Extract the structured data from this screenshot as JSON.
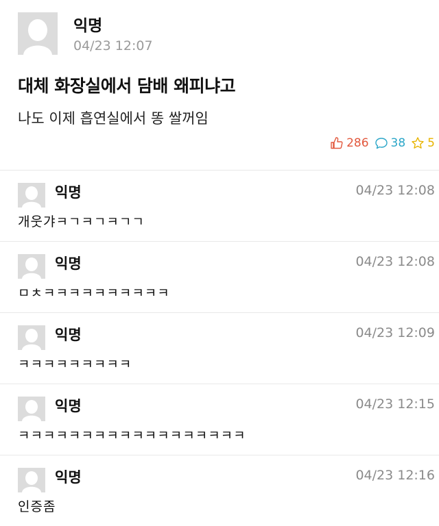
{
  "post": {
    "author": "익명",
    "time": "04/23 12:07",
    "title": "대체 화장실에서 담배 왜피냐고",
    "body": "나도 이제 흡연실에서 똥 쌀꺼임",
    "likes": "286",
    "comments": "38",
    "scraps": "5"
  },
  "comments": [
    {
      "author": "익명",
      "time": "04/23 12:08",
      "text": "개웃갸ㅋㄱㅋㄱㅋㄱㄱ"
    },
    {
      "author": "익명",
      "time": "04/23 12:08",
      "text": "ㅁㅊㅋㅋㅋㅋㅋㅋㅋㅋㅋㅋ"
    },
    {
      "author": "익명",
      "time": "04/23 12:09",
      "text": "ㅋㅋㅋㅋㅋㅋㅋㅋㅋ"
    },
    {
      "author": "익명",
      "time": "04/23 12:15",
      "text": "ㅋㅋㅋㅋㅋㅋㅋㅋㅋㅋㅋㅋㅋㅋㅋㅋㅋㅋ"
    },
    {
      "author": "익명",
      "time": "04/23 12:16",
      "text": "인증좀"
    }
  ],
  "colors": {
    "like": "#e2583d",
    "comment": "#2ba6c8",
    "scrap": "#e8b400"
  }
}
